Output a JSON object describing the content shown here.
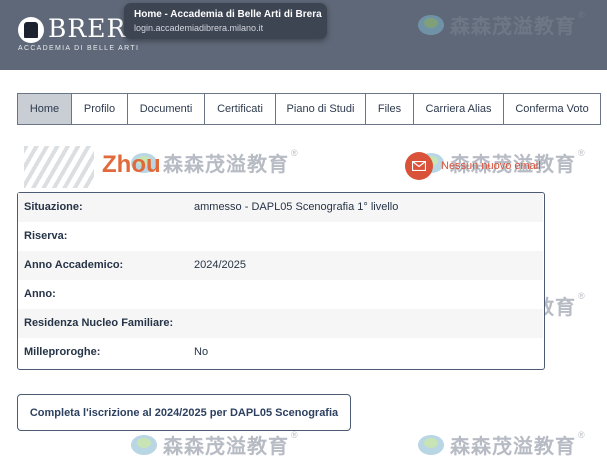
{
  "header": {
    "logo_title": "BRERA",
    "logo_subtitle": "ACCADEMIA DI BELLE ARTI"
  },
  "tooltip": {
    "title": "Home - Accademia di Belle Arti di Brera",
    "url": "login.accademiadibrera.milano.it"
  },
  "nav": {
    "tabs": [
      {
        "label": "Home",
        "active": true
      },
      {
        "label": "Profilo"
      },
      {
        "label": "Documenti"
      },
      {
        "label": "Certificati"
      },
      {
        "label": "Piano di Studi"
      },
      {
        "label": "Files"
      },
      {
        "label": "Carriera Alias"
      },
      {
        "label": "Conferma Voto"
      }
    ]
  },
  "overlay": {
    "zhou_text": "Zhou",
    "watermark_text": "森森茂溢教育",
    "watermark_mark": "®"
  },
  "notification": {
    "text": "Nessun nuovo email",
    "icon": "mail-icon",
    "color": "#d9533b"
  },
  "status_table": {
    "rows": [
      {
        "label": "Situazione:",
        "value": "ammesso - DAPL05 Scenografia 1° livello"
      },
      {
        "label": "Riserva:",
        "value": ""
      },
      {
        "label": "Anno Accademico:",
        "value": "2024/2025"
      },
      {
        "label": "Anno:",
        "value": ""
      },
      {
        "label": "Residenza Nucleo Familiare:",
        "value": ""
      },
      {
        "label": "Milleproroghe:",
        "value": "No"
      }
    ]
  },
  "actions": {
    "complete_label": "Completa l'iscrizione al 2024/2025 per DAPL05 Scenografia"
  },
  "colors": {
    "header_bg": "#5f6878",
    "border": "#4d5a73",
    "active_tab": "#c9cdd4"
  }
}
